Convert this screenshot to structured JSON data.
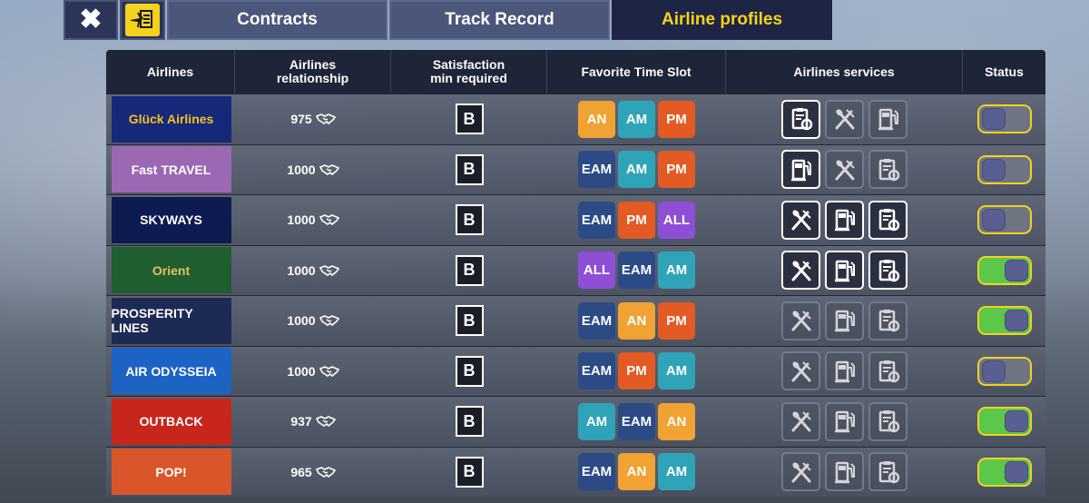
{
  "topbar": {
    "close_icon": "close-icon",
    "plane_icon": "plane-schedule-icon",
    "tabs": [
      {
        "label": "Contracts",
        "active": false
      },
      {
        "label": "Track Record",
        "active": false
      },
      {
        "label": "Airline profiles",
        "active": true
      }
    ]
  },
  "table": {
    "headers": {
      "airlines": "Airlines",
      "relationship": "Airlines\nrelationship",
      "satisfaction": "Satisfaction\nmin required",
      "slot": "Favorite Time Slot",
      "services": "Airlines services",
      "status": "Status"
    },
    "slot_colors": {
      "AN": "#f0a232",
      "AM": "#2fa4b8",
      "PM": "#e35a23",
      "EAM": "#2b4a86",
      "ALL": "#8e4fd6"
    },
    "rows": [
      {
        "airline": "Glück Airlines",
        "logo_bg": "#16287a",
        "logo_color": "#f4c21e",
        "relationship": "975",
        "grade": "B",
        "slots": [
          "AN",
          "AM",
          "PM"
        ],
        "services": [
          {
            "icon": "clipboard-icon",
            "active": true
          },
          {
            "icon": "fork-knife-icon",
            "active": false
          },
          {
            "icon": "fuel-pump-icon",
            "active": false
          }
        ],
        "status_on": false
      },
      {
        "airline": "Fast TRAVEL",
        "logo_bg": "#9b68b4",
        "logo_color": "#ffffff",
        "relationship": "1000",
        "grade": "B",
        "slots": [
          "EAM",
          "AM",
          "PM"
        ],
        "services": [
          {
            "icon": "fuel-pump-icon",
            "active": true
          },
          {
            "icon": "fork-knife-icon",
            "active": false
          },
          {
            "icon": "clipboard-icon",
            "active": false
          }
        ],
        "status_on": false
      },
      {
        "airline": "SKYWAYS",
        "logo_bg": "#0e1b50",
        "logo_color": "#ffffff",
        "relationship": "1000",
        "grade": "B",
        "slots": [
          "EAM",
          "PM",
          "ALL"
        ],
        "services": [
          {
            "icon": "fork-knife-icon",
            "active": true
          },
          {
            "icon": "fuel-pump-icon",
            "active": true
          },
          {
            "icon": "clipboard-icon",
            "active": true
          }
        ],
        "status_on": false
      },
      {
        "airline": "Orient",
        "logo_bg": "#1f5e2e",
        "logo_color": "#e8c25c",
        "relationship": "1000",
        "grade": "B",
        "slots": [
          "ALL",
          "EAM",
          "AM"
        ],
        "services": [
          {
            "icon": "fork-knife-icon",
            "active": true
          },
          {
            "icon": "fuel-pump-icon",
            "active": true
          },
          {
            "icon": "clipboard-icon",
            "active": true
          }
        ],
        "status_on": true
      },
      {
        "airline": "PROSPERITY LINES",
        "logo_bg": "#1c2a54",
        "logo_color": "#ffffff",
        "relationship": "1000",
        "grade": "B",
        "slots": [
          "EAM",
          "AN",
          "PM"
        ],
        "services": [
          {
            "icon": "fork-knife-icon",
            "active": false
          },
          {
            "icon": "fuel-pump-icon",
            "active": false
          },
          {
            "icon": "clipboard-icon",
            "active": false
          }
        ],
        "status_on": true
      },
      {
        "airline": "AIR ODYSSEIA",
        "logo_bg": "#1c63c4",
        "logo_color": "#ffffff",
        "relationship": "1000",
        "grade": "B",
        "slots": [
          "EAM",
          "PM",
          "AM"
        ],
        "services": [
          {
            "icon": "fork-knife-icon",
            "active": false
          },
          {
            "icon": "fuel-pump-icon",
            "active": false
          },
          {
            "icon": "clipboard-icon",
            "active": false
          }
        ],
        "status_on": false
      },
      {
        "airline": "OUTBACK",
        "logo_bg": "#c8261c",
        "logo_color": "#ffffff",
        "relationship": "937",
        "grade": "B",
        "slots": [
          "AM",
          "EAM",
          "AN"
        ],
        "services": [
          {
            "icon": "fork-knife-icon",
            "active": false
          },
          {
            "icon": "fuel-pump-icon",
            "active": false
          },
          {
            "icon": "clipboard-icon",
            "active": false
          }
        ],
        "status_on": true
      },
      {
        "airline": "POP!",
        "logo_bg": "#d8562a",
        "logo_color": "#ffffff",
        "relationship": "965",
        "grade": "B",
        "slots": [
          "EAM",
          "AN",
          "AM"
        ],
        "services": [
          {
            "icon": "fork-knife-icon",
            "active": false
          },
          {
            "icon": "fuel-pump-icon",
            "active": false
          },
          {
            "icon": "clipboard-icon",
            "active": false
          }
        ],
        "status_on": true
      }
    ]
  }
}
